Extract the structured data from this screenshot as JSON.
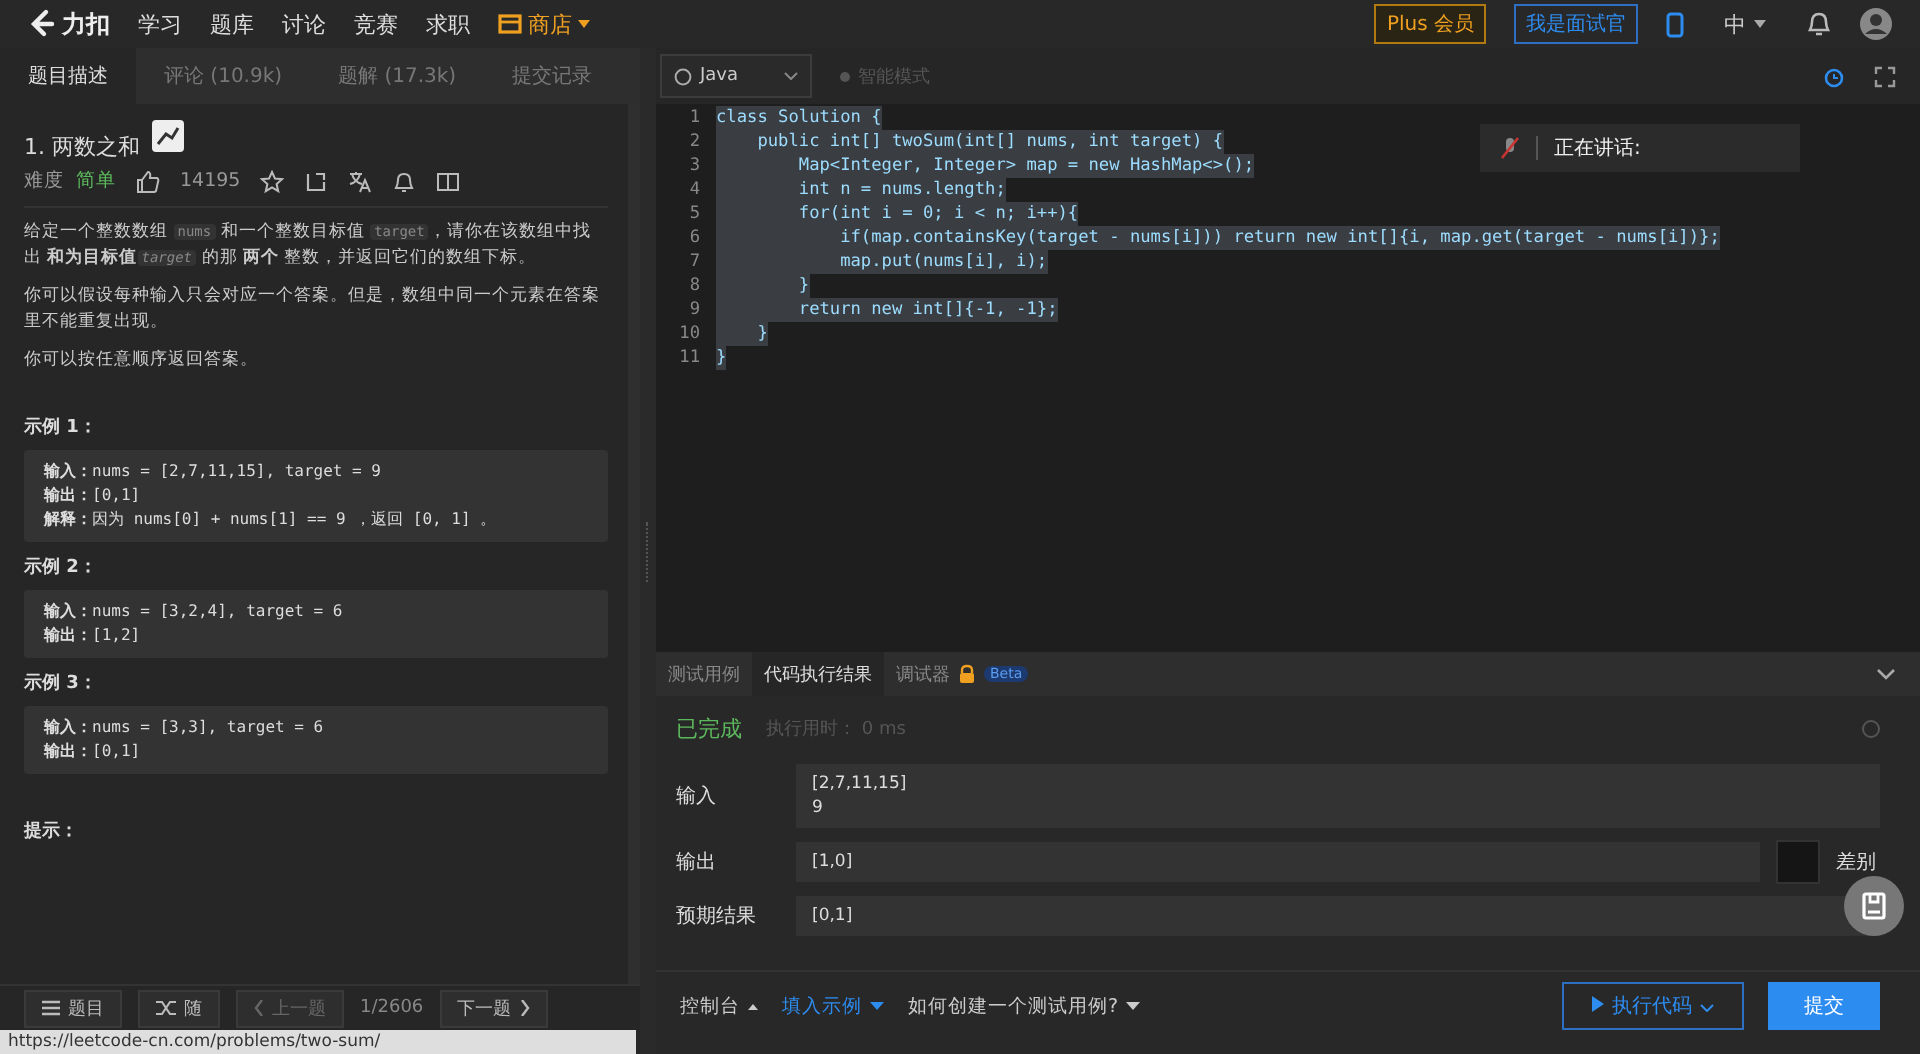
{
  "nav": {
    "logo": "力扣",
    "items": [
      {
        "label": "学习",
        "kind": "link"
      },
      {
        "label": "题库",
        "kind": "link"
      },
      {
        "label": "讨论",
        "kind": "link"
      },
      {
        "label": "竞赛",
        "kind": "link"
      },
      {
        "label": "求职",
        "kind": "link"
      },
      {
        "label": "商店",
        "kind": "shop"
      }
    ],
    "plus": "Plus 会员",
    "interviewer": "我是面试官",
    "lang": "中"
  },
  "left_tabs": [
    {
      "label": "题目描述",
      "selected": true
    },
    {
      "label": "评论 (10.9k)",
      "selected": false
    },
    {
      "label": "题解 (17.3k)",
      "selected": false
    },
    {
      "label": "提交记录",
      "selected": false
    }
  ],
  "problem": {
    "title": "1. 两数之和",
    "difficulty_label": "难度",
    "difficulty": "简单",
    "likes": "14195",
    "paragraphs": [
      [
        {
          "kind": "text",
          "text": "给定一个整数数组 "
        },
        {
          "kind": "code",
          "text": "nums"
        },
        {
          "kind": "text",
          "text": " 和一个整数目标值 "
        },
        {
          "kind": "code",
          "text": "target"
        },
        {
          "kind": "text",
          "text": "，请你在该数组中找出 "
        },
        {
          "kind": "bold",
          "text": "和为目标值"
        },
        {
          "kind": "var",
          "text": "target"
        },
        {
          "kind": "text",
          "text": " 的那 "
        },
        {
          "kind": "bold",
          "text": "两个"
        },
        {
          "kind": "text",
          "text": " 整数，并返回它们的数组下标。"
        }
      ],
      [
        {
          "kind": "text",
          "text": "你可以假设每种输入只会对应一个答案。但是，数组中同一个元素在答案里不能重复出现。"
        }
      ],
      [
        {
          "kind": "text",
          "text": "你可以按任意顺序返回答案。"
        }
      ]
    ],
    "examples": [
      {
        "title": "示例 1：",
        "lines": [
          "**输入：**nums = [2,7,11,15], target = 9",
          "**输出：**[0,1]",
          "**解释：**因为 nums[0] + nums[1] == 9 ，返回 [0, 1] 。"
        ]
      },
      {
        "title": "示例 2：",
        "lines": [
          "**输入：**nums = [3,2,4], target = 6",
          "**输出：**[1,2]"
        ]
      },
      {
        "title": "示例 3：",
        "lines": [
          "**输入：**nums = [3,3], target = 6",
          "**输出：**[0,1]"
        ]
      }
    ],
    "hint_title": "提示："
  },
  "pager": {
    "list": "题目",
    "random": "随",
    "prev": "上一题",
    "count": "1/2606",
    "next": "下一题"
  },
  "status_url": "https://leetcode-cn.com/problems/two-sum/",
  "editor": {
    "language": "Java",
    "mode": "智能模式",
    "lines": [
      {
        "n": "1",
        "code": "class Solution {"
      },
      {
        "n": "2",
        "code": "    public int[] twoSum(int[] nums, int target) {"
      },
      {
        "n": "3",
        "code": "        Map<Integer, Integer> map = new HashMap<>();"
      },
      {
        "n": "4",
        "code": "        int n = nums.length;"
      },
      {
        "n": "5",
        "code": "        for(int i = 0; i < n; i++){"
      },
      {
        "n": "6",
        "code": "            if(map.containsKey(target - nums[i])) return new int[]{i, map.get(target - nums[i])};"
      },
      {
        "n": "7",
        "code": "            map.put(nums[i], i);"
      },
      {
        "n": "8",
        "code": "        }"
      },
      {
        "n": "9",
        "code": "        return new int[]{-1, -1};"
      },
      {
        "n": "10",
        "code": "    }"
      },
      {
        "n": "11",
        "code": "}"
      }
    ]
  },
  "popup": {
    "text": "正在讲话:"
  },
  "console": {
    "tabs": [
      {
        "label": "测试用例",
        "selected": false,
        "locked": false
      },
      {
        "label": "代码执行结果",
        "selected": true,
        "locked": false
      },
      {
        "label": "调试器",
        "selected": false,
        "locked": true,
        "badge": "Beta"
      }
    ],
    "status": "已完成",
    "runtime": "执行用时： 0 ms",
    "fields": [
      {
        "label": "输入",
        "lines": [
          "[2,7,11,15]",
          "9"
        ],
        "kind": "plain"
      },
      {
        "label": "输出",
        "lines": [
          "[1,0]"
        ],
        "kind": "diff",
        "diff_label": "差别"
      },
      {
        "label": "预期结果",
        "lines": [
          "[0,1]"
        ],
        "kind": "plain"
      }
    ],
    "footer": {
      "console": "控制台",
      "fill": "填入示例",
      "howto": "如何创建一个测试用例?",
      "run": "执行代码",
      "submit": "提交"
    }
  }
}
